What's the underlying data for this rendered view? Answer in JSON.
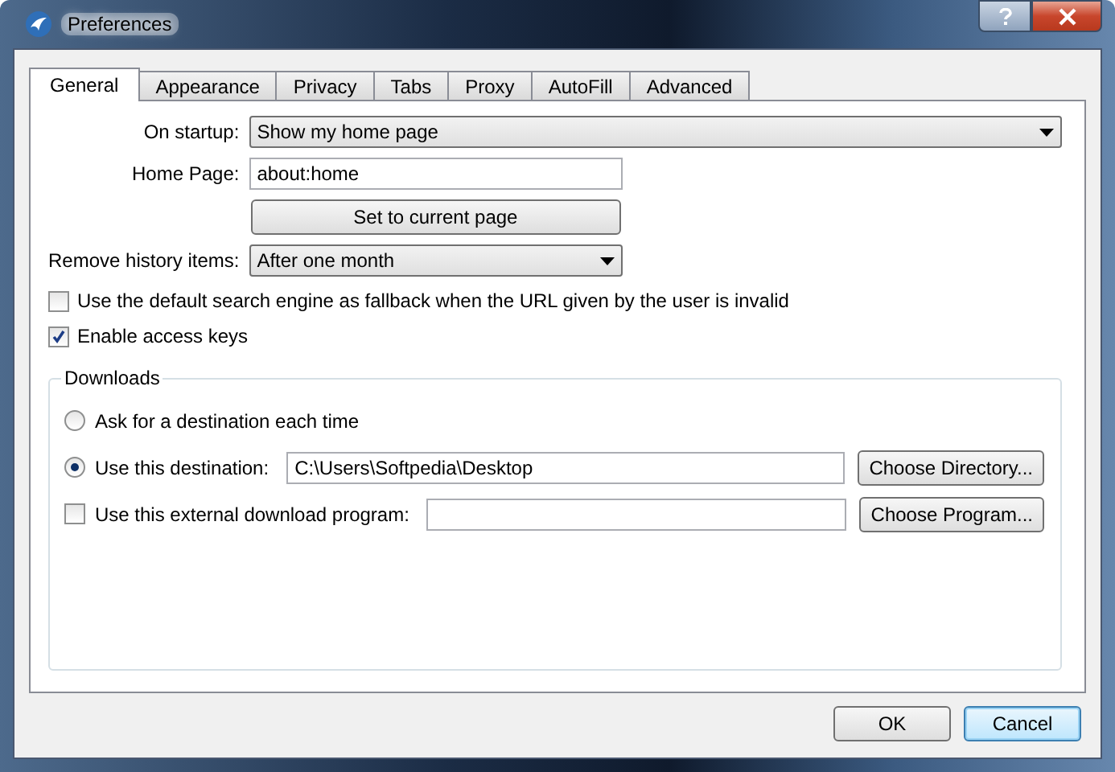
{
  "window": {
    "title": "Preferences"
  },
  "tabs": [
    {
      "label": "General",
      "selected": true
    },
    {
      "label": "Appearance",
      "selected": false
    },
    {
      "label": "Privacy",
      "selected": false
    },
    {
      "label": "Tabs",
      "selected": false
    },
    {
      "label": "Proxy",
      "selected": false
    },
    {
      "label": "AutoFill",
      "selected": false
    },
    {
      "label": "Advanced",
      "selected": false
    }
  ],
  "general": {
    "startup": {
      "label": "On startup:",
      "value": "Show my home page"
    },
    "home_page": {
      "label": "Home Page:",
      "value": "about:home"
    },
    "set_current_button": "Set to current page",
    "history": {
      "label": "Remove history items:",
      "value": "After one month"
    },
    "options": [
      {
        "label": "Use the default search engine as fallback when the URL given by the user is invalid",
        "checked": false
      },
      {
        "label": "Enable access keys",
        "checked": true
      }
    ],
    "downloads": {
      "title": "Downloads",
      "choices": [
        {
          "kind": "radio",
          "label": "Ask for a destination each time",
          "selected": false
        },
        {
          "kind": "radio",
          "label": "Use this destination:",
          "selected": true,
          "value": "C:\\Users\\Softpedia\\Desktop",
          "button": "Choose Directory..."
        },
        {
          "kind": "checkbox",
          "label": "Use this external download program:",
          "checked": false,
          "button": "Choose Program..."
        }
      ]
    }
  },
  "buttons": [
    {
      "label": "OK",
      "focused": false
    },
    {
      "label": "Cancel",
      "focused": true
    }
  ]
}
